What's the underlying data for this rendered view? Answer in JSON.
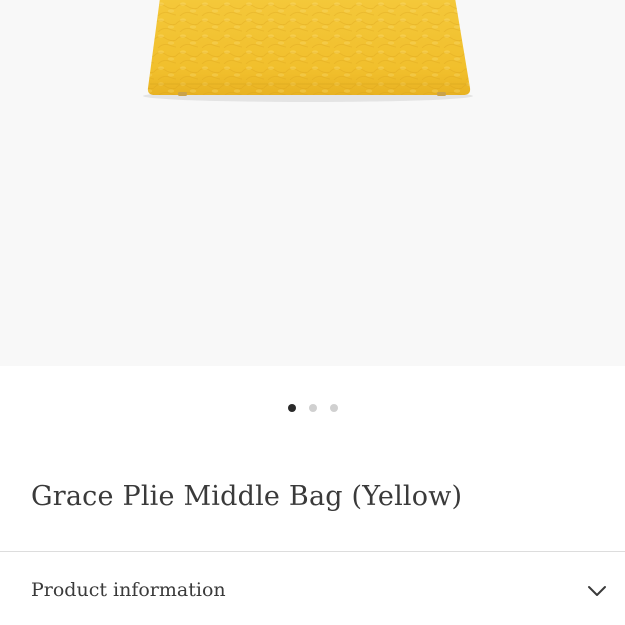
{
  "product": {
    "title": "Grace Plie Middle Bag (Yellow)",
    "image": {
      "subject": "yellow croc-embossed bag"
    },
    "gallery": {
      "total": 3,
      "active_index": 1
    }
  },
  "accordion": {
    "label": "Product information",
    "expanded": false,
    "icon": "chevron-down-icon"
  },
  "colors": {
    "bag": "#f2c231",
    "image_background": "#f8f8f8",
    "text": "#3a3a3a",
    "dot_active": "#2a2a2a",
    "dot_inactive": "#d0d0d0"
  }
}
